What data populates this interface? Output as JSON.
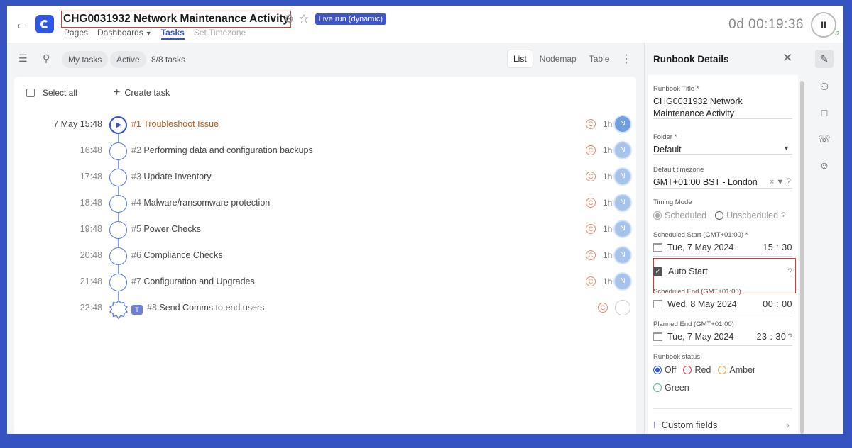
{
  "header": {
    "title": "CHG0031932 Network Maintenance Activity",
    "live_badge": "Live run (dynamic)",
    "nav": {
      "pages": "Pages",
      "dashboards": "Dashboards",
      "tasks": "Tasks",
      "set_timezone": "Set Timezone"
    },
    "timer": "0d 00:19:36",
    "pause_label": "II"
  },
  "toolbar": {
    "my_tasks": "My tasks",
    "active": "Active",
    "count": "8/8 tasks",
    "views": [
      "List",
      "Nodemap",
      "Table"
    ],
    "selected_view": "List"
  },
  "task_list": {
    "select_all": "Select all",
    "create_task": "Create task",
    "tasks": [
      {
        "time": "7 May 15:48",
        "num": "#1",
        "name": "Troubleshoot Issue",
        "duration": "1h",
        "avatar": "N"
      },
      {
        "time": "16:48",
        "num": "#2",
        "name": "Performing data and configuration backups",
        "duration": "1h",
        "avatar": "N"
      },
      {
        "time": "17:48",
        "num": "#3",
        "name": "Update Inventory",
        "duration": "1h",
        "avatar": "N"
      },
      {
        "time": "18:48",
        "num": "#4",
        "name": "Malware/ransomware protection",
        "duration": "1h",
        "avatar": "N"
      },
      {
        "time": "19:48",
        "num": "#5",
        "name": "Power Checks",
        "duration": "1h",
        "avatar": "N"
      },
      {
        "time": "20:48",
        "num": "#6",
        "name": "Compliance Checks",
        "duration": "1h",
        "avatar": "N"
      },
      {
        "time": "21:48",
        "num": "#7",
        "name": "Configuration and Upgrades",
        "duration": "1h",
        "avatar": "N"
      },
      {
        "time": "22:48",
        "num": "#8",
        "name": "Send Comms to end users",
        "duration": "",
        "avatar": ""
      }
    ]
  },
  "panel": {
    "title": "Runbook Details",
    "runbook_title_label": "Runbook Title *",
    "runbook_title_value": "CHG0031932 Network Maintenance Activity",
    "folder_label": "Folder *",
    "folder_value": "Default",
    "timezone_label": "Default timezone",
    "timezone_value": "GMT+01:00 BST - London",
    "timing_label": "Timing Mode",
    "timing_scheduled": "Scheduled",
    "timing_unscheduled": "Unscheduled",
    "sched_start_label": "Scheduled Start (GMT+01:00) *",
    "sched_start_date": "Tue, 7 May 2024",
    "sched_start_time": "15 : 30",
    "auto_start": "Auto Start",
    "sched_end_label": "Scheduled End (GMT+01:00)",
    "sched_end_date": "Wed, 8 May 2024",
    "sched_end_time": "00 : 00",
    "planned_end_label": "Planned End (GMT+01:00)",
    "planned_end_date": "Tue, 7 May 2024",
    "planned_end_time": "23 : 30",
    "status_label": "Runbook status",
    "status_off": "Off",
    "status_red": "Red",
    "status_amber": "Amber",
    "status_green": "Green",
    "custom_fields": "Custom fields"
  },
  "colors": {
    "brand": "#3653c2",
    "highlight": "#d93838",
    "active_task": "#b25a1e"
  }
}
